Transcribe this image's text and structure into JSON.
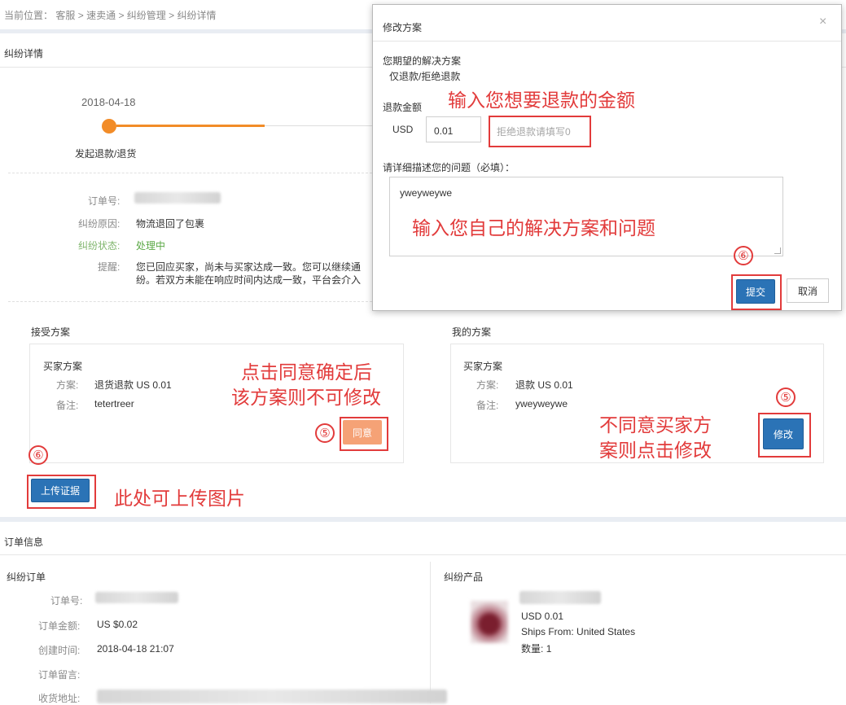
{
  "breadcrumb": {
    "prefix": "当前位置：",
    "items": [
      "客服",
      "速卖通",
      "纠纷管理",
      "纠纷详情"
    ],
    "separator": ">"
  },
  "dispute": {
    "section_title": "纠纷详情",
    "timeline_date": "2018-04-18",
    "timeline_step": "发起退款/退货",
    "order_no_label": "订单号:",
    "reason_label": "纠纷原因:",
    "reason_value": "物流退回了包裹",
    "status_label": "纠纷状态:",
    "status_value": "处理中",
    "remind_label": "提醒:",
    "remind_line1": "您已回应买家，尚未与买家达成一致。您可以继续通",
    "remind_line2": "纷。若双方未能在响应时间内达成一致，平台会介入"
  },
  "accept_plan": {
    "title": "接受方案",
    "card_title": "买家方案",
    "plan_label": "方案:",
    "plan_value": "退货退款 US 0.01",
    "note_label": "备注:",
    "note_value": "tetertreer",
    "agree_label": "同意"
  },
  "my_plan": {
    "title": "我的方案",
    "card_title": "买家方案",
    "plan_label": "方案:",
    "plan_value": "退款 US 0.01",
    "note_label": "备注:",
    "note_value": "yweyweywe",
    "modify_label": "修改"
  },
  "upload": {
    "label": "上传证据"
  },
  "order_info": {
    "section_title": "订单信息",
    "left_title": "纠纷订单",
    "order_no_label": "订单号:",
    "amount_label": "订单金额:",
    "amount_value": "US $0.02",
    "created_label": "创建时间:",
    "created_value": "2018-04-18 21:07",
    "message_label": "订单留言:",
    "address_label": "收货地址:",
    "right_title": "纠纷产品",
    "product_price": "USD 0.01",
    "ships_from_label": "Ships From:",
    "ships_from_value": "United States",
    "qty_label": "数量:",
    "qty_value": "1"
  },
  "modal": {
    "title": "修改方案",
    "close_symbol": "×",
    "expected_label": "您期望的解决方案",
    "expected_value": "仅退款/拒绝退款",
    "amount_label": "退款金额",
    "currency": "USD",
    "amount_value": "0.01",
    "amount_hint": "拒绝退款请填写0",
    "desc_label": "请详细描述您的问题（必填）：",
    "desc_value": "yweyweywe",
    "submit_label": "提交",
    "cancel_label": "取消"
  },
  "annotations": {
    "enter_amount": "输入您想要退款的金额",
    "enter_solution": "输入您自己的解决方案和问题",
    "agree_line1": "点击同意确定后",
    "agree_line2": "该方案则不可修改",
    "modify_line1": "不同意买家方",
    "modify_line2": "案则点击修改",
    "upload_hint": "此处可上传图片",
    "num5": "⑤",
    "num6": "⑥"
  },
  "colors": {
    "primary_blue": "#2b73b6",
    "accent_orange": "#f28c28",
    "status_green": "#5aa845",
    "annotation_red": "#e23b3b"
  }
}
